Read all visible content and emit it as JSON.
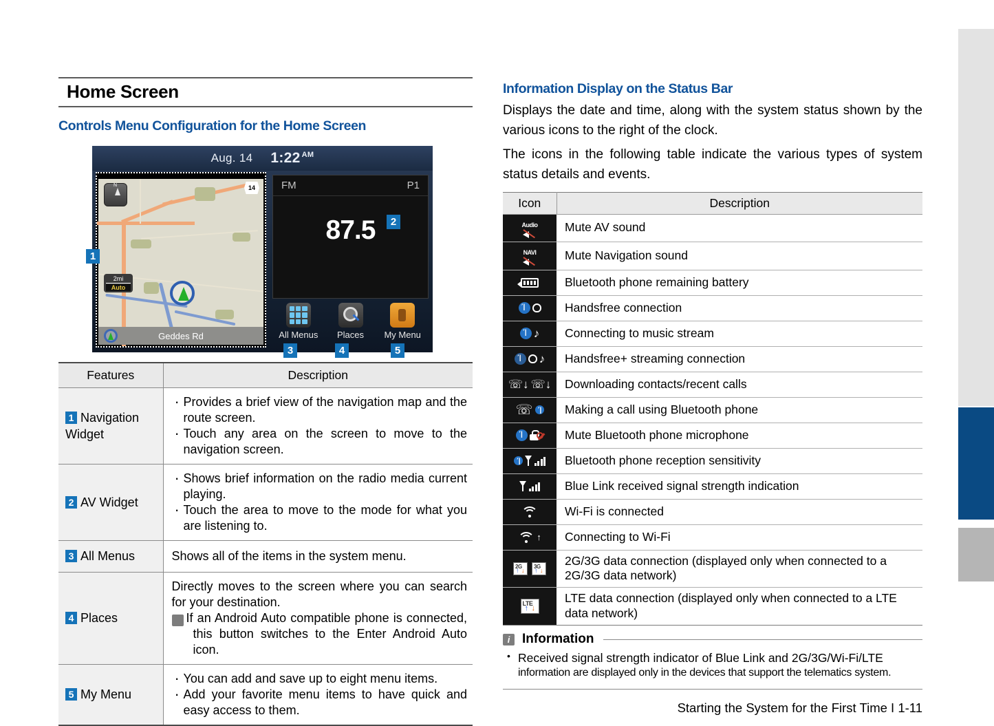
{
  "left": {
    "heading": "Home Screen",
    "subheading": "Controls Menu Configuration for the Home Screen",
    "device_screen": {
      "status_date": "Aug. 14",
      "status_time": "1:22",
      "status_ampm": "AM",
      "map": {
        "compass_label": "N",
        "route_shield": "14",
        "scale_distance": "2mi",
        "scale_mode": "Auto",
        "street_label": "Geddes Rd"
      },
      "av": {
        "source": "FM",
        "preset": "P1",
        "frequency": "87.5"
      },
      "buttons": [
        {
          "label": "All Menus",
          "icon": "grid-icon",
          "badge": "3"
        },
        {
          "label": "Places",
          "icon": "search-icon",
          "badge": "4"
        },
        {
          "label": "My Menu",
          "icon": "folder-icon",
          "badge": "5"
        }
      ],
      "badges": {
        "nav": "1",
        "av": "2"
      }
    },
    "features_table": {
      "headers": [
        "Features",
        "Description"
      ],
      "rows": [
        {
          "num": "1",
          "feature": "Navigation Widget",
          "bullets": [
            "Provides a brief view of the navigation map and the route screen.",
            "Touch any area on the screen to move to the navigation screen."
          ]
        },
        {
          "num": "2",
          "feature": "AV Widget",
          "bullets": [
            "Shows brief information on the radio media current playing.",
            "Touch the area to move to the mode for what you are listening to."
          ]
        },
        {
          "num": "3",
          "feature": "All Menus",
          "plain": "Shows all of the items in the system menu."
        },
        {
          "num": "4",
          "feature": "Places",
          "plain": "Directly moves to the screen where you can search for your destination.",
          "note": "If an Android Auto compatible phone is connected, this button switches to the Enter Android Auto icon."
        },
        {
          "num": "5",
          "feature": "My Menu",
          "bullets": [
            "You can add and save up to eight menu items.",
            "Add your favorite menu items to have quick and easy access to them."
          ]
        }
      ]
    }
  },
  "right": {
    "heading": "Information Display on the Status Bar",
    "paragraphs": [
      "Displays the date and time, along with the system status shown by the various icons to the right of the clock.",
      "The icons in the following table indicate the various types of system status details and events."
    ],
    "icon_table": {
      "headers": [
        "Icon",
        "Description"
      ],
      "rows": [
        {
          "icon": "mute-av-sound-icon",
          "desc": "Mute AV sound"
        },
        {
          "icon": "mute-navigation-sound-icon",
          "desc": "Mute Navigation sound"
        },
        {
          "icon": "bluetooth-battery-icon",
          "desc": "Bluetooth phone remaining battery"
        },
        {
          "icon": "handsfree-connection-icon",
          "desc": "Handsfree connection"
        },
        {
          "icon": "music-stream-icon",
          "desc": "Connecting to music stream"
        },
        {
          "icon": "handsfree-streaming-icon",
          "desc": "Handsfree+ streaming connection"
        },
        {
          "icon": "downloading-contacts-icon",
          "desc": "Downloading contacts/recent calls"
        },
        {
          "icon": "bluetooth-call-icon",
          "desc": "Making a call using Bluetooth phone"
        },
        {
          "icon": "mute-bluetooth-microphone-icon",
          "desc": "Mute Bluetooth phone microphone"
        },
        {
          "icon": "bluetooth-signal-icon",
          "desc": "Bluetooth phone reception sensitivity"
        },
        {
          "icon": "blue-link-signal-icon",
          "desc": "Blue Link received signal strength indication"
        },
        {
          "icon": "wifi-connected-icon",
          "desc": "Wi-Fi is connected"
        },
        {
          "icon": "wifi-connecting-icon",
          "desc": "Connecting to Wi-Fi"
        },
        {
          "icon": "2g-3g-data-icon",
          "desc": "2G/3G data connection (displayed only when connected to a 2G/3G data network)"
        },
        {
          "icon": "lte-data-icon",
          "desc": "LTE data connection (displayed only when connected to a LTE data network)"
        }
      ]
    },
    "information": {
      "title": "Information",
      "line1": "Received signal strength indicator of Blue Link and 2G/3G/Wi-Fi/LTE",
      "line2": "information are displayed only in the devices that support the telematics system."
    },
    "footer": "Starting the System for the First Time I 1-11"
  },
  "colors": {
    "accent_blue": "#11539b",
    "badge_blue": "#1573b8",
    "tab_blue": "#0a4a83"
  }
}
